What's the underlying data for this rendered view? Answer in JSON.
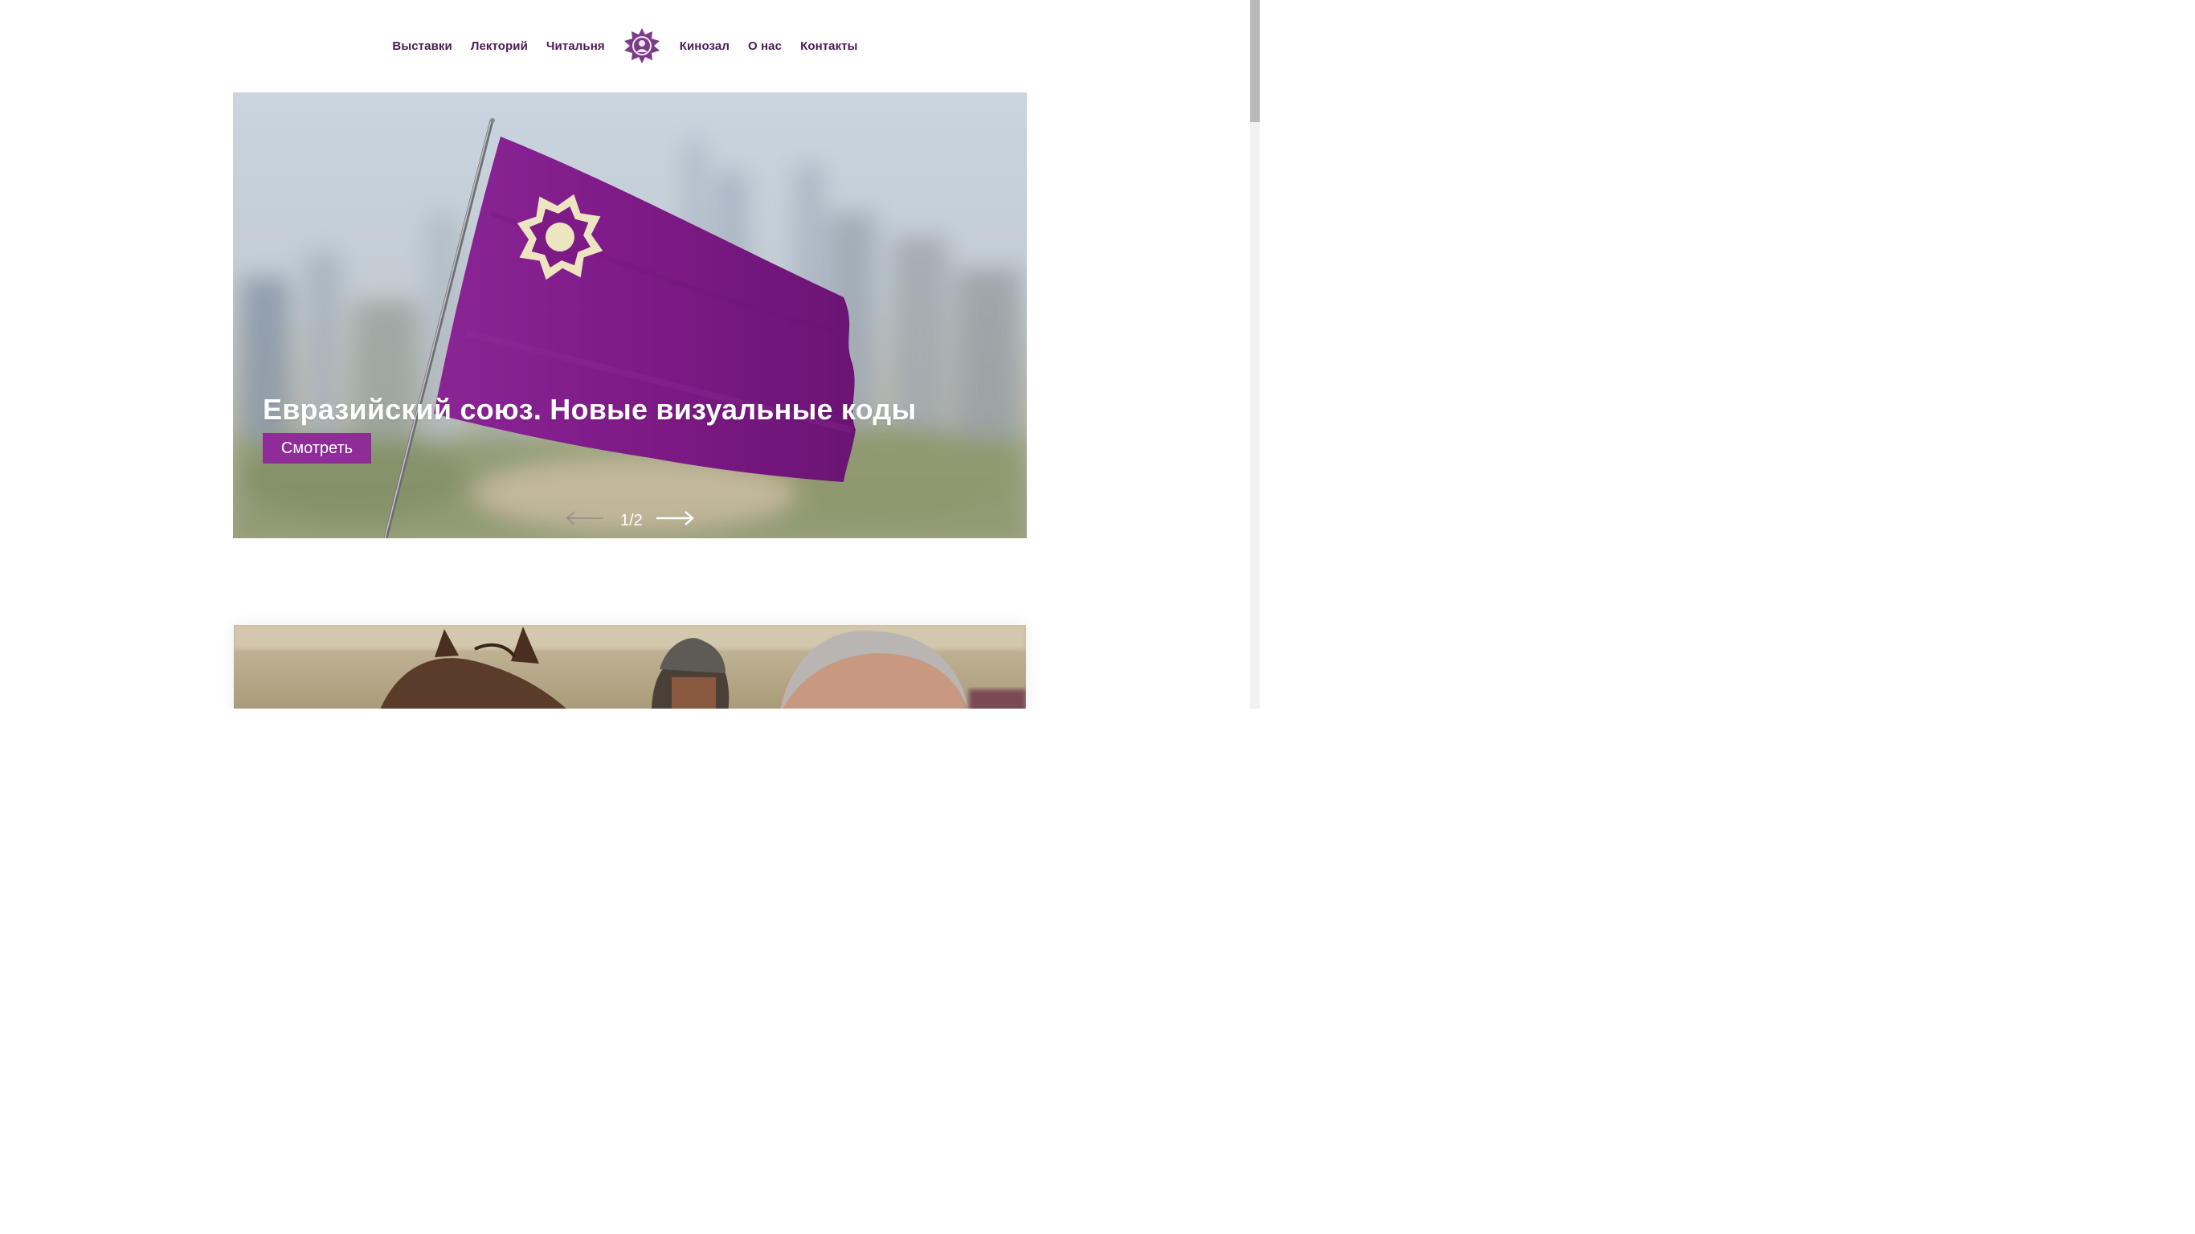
{
  "nav": {
    "left_items": [
      {
        "label": "Выставки"
      },
      {
        "label": "Лекторий"
      },
      {
        "label": "Читальня"
      }
    ],
    "right_items": [
      {
        "label": "Кинозал"
      },
      {
        "label": "О нас"
      },
      {
        "label": "Контакты"
      }
    ],
    "logo_icon": "star-emblem-icon"
  },
  "hero": {
    "title": "Евразийский союз. Новые визуальные коды",
    "button_label": "Смотреть",
    "counter": "1/2",
    "prev_icon": "arrow-left-icon",
    "next_icon": "arrow-right-icon"
  },
  "colors": {
    "brand_purple": "#8f2d98",
    "nav_text": "#4d1b57",
    "flag_purple": "#7d1a86",
    "emblem_cream": "#ede4c0"
  }
}
